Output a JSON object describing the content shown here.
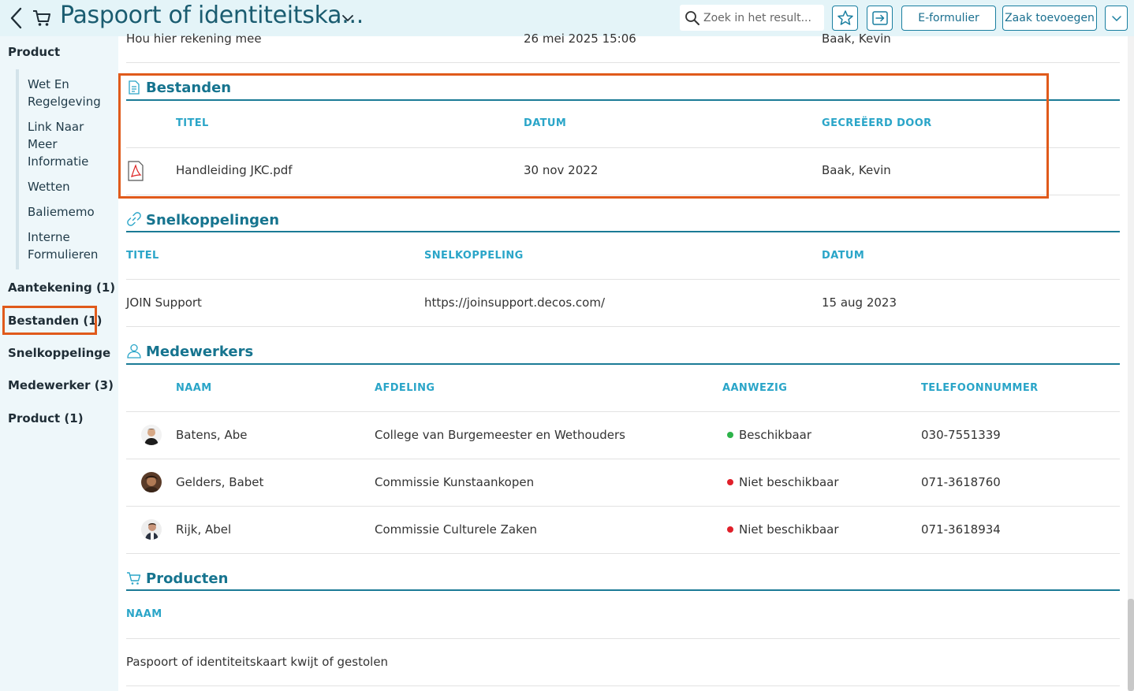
{
  "header": {
    "title": "Paspoort of identiteitska...",
    "search_placeholder": "Zoek in het result...",
    "eformulier_label": "E-formulier",
    "zaak_label": "Zaak toevoegen"
  },
  "sidebar": {
    "product_label": "Product",
    "sub_items": [
      "Wet En Regelgeving",
      "Link Naar Meer Informatie",
      "Wetten",
      "Baliememo",
      "Interne Formulieren"
    ],
    "aantekening_label": "Aantekening (1)",
    "bestanden_label": "Bestanden (1)",
    "snelkoppelingen_label": "Snelkoppelinge...",
    "medewerker_label": "Medewerker (3)",
    "product_count_label": "Product (1)"
  },
  "top_row": {
    "text": "Hou hier rekening mee",
    "date": "26 mei 2025 15:06",
    "author": "Baak, Kevin"
  },
  "bestanden": {
    "title": "Bestanden",
    "col_titel": "TITEL",
    "col_datum": "DATUM",
    "col_door": "GECREËERD DOOR",
    "file_name": "Handleiding JKC.pdf",
    "file_date": "30 nov 2022",
    "file_author": "Baak, Kevin"
  },
  "snelkoppelingen": {
    "title": "Snelkoppelingen",
    "col_titel": "TITEL",
    "col_link": "SNELKOPPELING",
    "col_datum": "DATUM",
    "row_title": "JOIN Support",
    "row_link": "https://joinsupport.decos.com/",
    "row_date": "15 aug 2023"
  },
  "medewerkers": {
    "title": "Medewerkers",
    "col_naam": "NAAM",
    "col_afdeling": "AFDELING",
    "col_aanwezig": "AANWEZIG",
    "col_telefoon": "TELEFOONNUMMER",
    "rows": [
      {
        "name": "Batens, Abe",
        "dept": "College van Burgemeester en Wethouders",
        "status": "Beschikbaar",
        "phone": "030-7551339",
        "status_color": "#2db34a"
      },
      {
        "name": "Gelders, Babet",
        "dept": "Commissie Kunstaankopen",
        "status": "Niet beschikbaar",
        "phone": "071-3618760",
        "status_color": "#e0202a"
      },
      {
        "name": "Rijk, Abel",
        "dept": "Commissie Culturele Zaken",
        "status": "Niet beschikbaar",
        "phone": "071-3618934",
        "status_color": "#e0202a"
      }
    ]
  },
  "producten": {
    "title": "Producten",
    "col_naam": "NAAM",
    "row_name": "Paspoort of identiteitskaart kwijt of gestolen"
  },
  "colors": {
    "accent": "#16748f",
    "header_bg": "#e4f4f8",
    "highlight": "#e05a1b",
    "column_header": "#2aa5c8"
  }
}
